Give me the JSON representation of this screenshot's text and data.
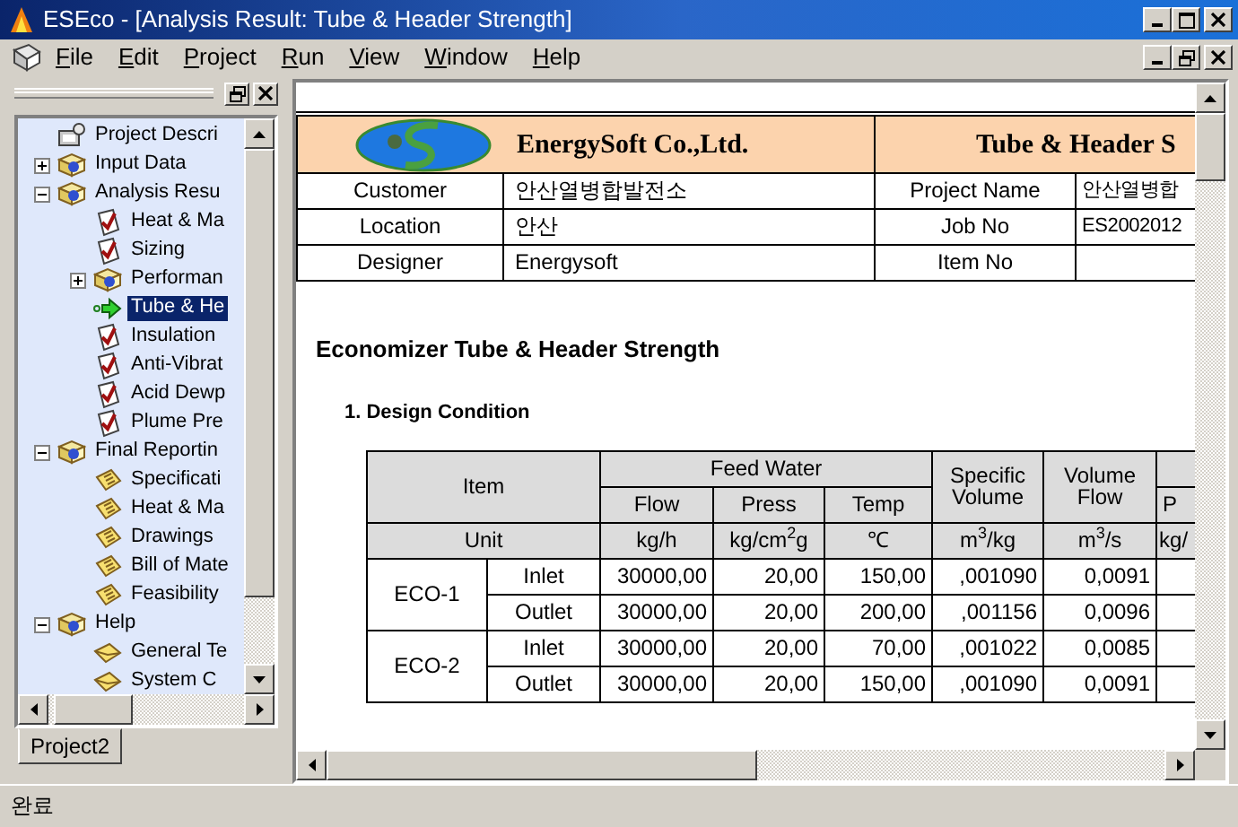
{
  "window": {
    "title": "ESEco - [Analysis Result: Tube & Header Strength]"
  },
  "menu": [
    "File",
    "Edit",
    "Project",
    "Run",
    "View",
    "Window",
    "Help"
  ],
  "project_tree": {
    "items": [
      {
        "label": "Project Descri",
        "kind": "project",
        "selected": false
      },
      {
        "label": "Input Data",
        "kind": "folder",
        "selected": false,
        "expanded": false
      },
      {
        "label": "Analysis Resu",
        "kind": "folder",
        "selected": false,
        "expanded": true,
        "children": [
          {
            "label": "Heat & Ma",
            "kind": "check",
            "selected": false
          },
          {
            "label": "Sizing",
            "kind": "check",
            "selected": false
          },
          {
            "label": "Performan",
            "kind": "folder",
            "selected": false,
            "expanded": false
          },
          {
            "label": "Tube & He",
            "kind": "arrow",
            "selected": true
          },
          {
            "label": "Insulation",
            "kind": "check",
            "selected": false
          },
          {
            "label": "Anti-Vibrat",
            "kind": "check",
            "selected": false
          },
          {
            "label": "Acid Dewp",
            "kind": "check",
            "selected": false
          },
          {
            "label": "Plume Pre",
            "kind": "check",
            "selected": false
          }
        ]
      },
      {
        "label": "Final Reportin",
        "kind": "folder",
        "selected": false,
        "expanded": true,
        "children": [
          {
            "label": "Specificati",
            "kind": "note",
            "selected": false
          },
          {
            "label": "Heat & Ma",
            "kind": "note",
            "selected": false
          },
          {
            "label": "Drawings",
            "kind": "note",
            "selected": false
          },
          {
            "label": "Bill of Mate",
            "kind": "note",
            "selected": false
          },
          {
            "label": "Feasibility",
            "kind": "note",
            "selected": false
          }
        ]
      },
      {
        "label": "Help",
        "kind": "folder",
        "selected": false,
        "expanded": true,
        "children": [
          {
            "label": "General Te",
            "kind": "envelope",
            "selected": false
          },
          {
            "label": "System C",
            "kind": "envelope",
            "selected": false
          }
        ]
      }
    ]
  },
  "pane_tabs": [
    {
      "label": "Project2",
      "selected": true
    }
  ],
  "document": {
    "company": "EnergySoft Co.,Ltd.",
    "report_title": "Tube & Header S",
    "info_rows": [
      {
        "label": "Customer",
        "value": "안산열병합발전소",
        "label_2": "Project Name",
        "value_2": "안산열병합"
      },
      {
        "label": "Location",
        "value": "안산",
        "label_2": "Job No",
        "value_2": "ES2002012"
      },
      {
        "label": "Designer",
        "value": "Energysoft",
        "label_2": "Item No"
      }
    ],
    "heading": "Economizer Tube & Header Strength",
    "section": "1. Design Condition",
    "design_table": {
      "item_header": "Item",
      "unit_header": "Unit",
      "group_header": "Feed Water",
      "group_columns": [
        {
          "label": "Flow",
          "unit": "kg/h"
        },
        {
          "label": "Press",
          "unit": "kg/cm$^{2}$g"
        },
        {
          "label": "Temp",
          "unit": "℃"
        }
      ],
      "other_columns": [
        {
          "label": "Specific Volume",
          "unit": "m$^{3}$/kg"
        },
        {
          "label": "Volume Flow",
          "unit": "m$^{3}$/s"
        }
      ],
      "cut_group_columns": [
        {
          "label": "P",
          "unit": "kg/"
        }
      ],
      "groups": [
        {
          "name": "ECO-1",
          "rows": [
            {
              "label": "Inlet",
              "values": [
                "30000,00",
                "20,00",
                "150,00",
                ",001090",
                "0,0091"
              ]
            },
            {
              "label": "Outlet",
              "values": [
                "30000,00",
                "20,00",
                "200,00",
                ",001156",
                "0,0096"
              ]
            }
          ]
        },
        {
          "name": "ECO-2",
          "rows": [
            {
              "label": "Inlet",
              "values": [
                "30000,00",
                "20,00",
                "70,00",
                ",001022",
                "0,0085"
              ]
            },
            {
              "label": "Outlet",
              "values": [
                "30000,00",
                "20,00",
                "150,00",
                ",001090",
                "0,0091"
              ]
            }
          ]
        }
      ]
    }
  },
  "status_bar": "완료"
}
